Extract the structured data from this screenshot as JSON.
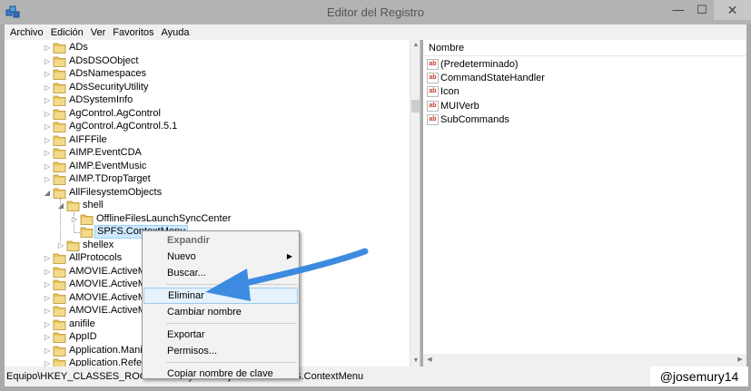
{
  "window": {
    "title": "Editor del Registro",
    "min_glyph": "—",
    "max_glyph": "☐",
    "close_glyph": "✕"
  },
  "menu": [
    "Archivo",
    "Edición",
    "Ver",
    "Favoritos",
    "Ayuda"
  ],
  "tree": [
    {
      "label": "ADs",
      "depth": 0,
      "expander": "collapsed"
    },
    {
      "label": "ADsDSOObject",
      "depth": 0,
      "expander": "collapsed"
    },
    {
      "label": "ADsNamespaces",
      "depth": 0,
      "expander": "collapsed"
    },
    {
      "label": "ADsSecurityUtility",
      "depth": 0,
      "expander": "collapsed"
    },
    {
      "label": "ADSystemInfo",
      "depth": 0,
      "expander": "collapsed"
    },
    {
      "label": "AgControl.AgControl",
      "depth": 0,
      "expander": "collapsed"
    },
    {
      "label": "AgControl.AgControl.5.1",
      "depth": 0,
      "expander": "collapsed"
    },
    {
      "label": "AIFFFile",
      "depth": 0,
      "expander": "collapsed"
    },
    {
      "label": "AIMP.EventCDA",
      "depth": 0,
      "expander": "collapsed"
    },
    {
      "label": "AIMP.EventMusic",
      "depth": 0,
      "expander": "collapsed"
    },
    {
      "label": "AIMP.TDropTarget",
      "depth": 0,
      "expander": "collapsed"
    },
    {
      "label": "AllFilesystemObjects",
      "depth": 0,
      "expander": "expanded"
    },
    {
      "label": "shell",
      "depth": 1,
      "expander": "expanded"
    },
    {
      "label": "OfflineFilesLaunchSyncCenter",
      "depth": 2,
      "expander": "collapsed"
    },
    {
      "label": "SPFS.ContextMenu",
      "depth": 2,
      "expander": "none",
      "selected": true
    },
    {
      "label": "shellex",
      "depth": 1,
      "expander": "collapsed"
    },
    {
      "label": "AllProtocols",
      "depth": 0,
      "expander": "collapsed"
    },
    {
      "label": "AMOVIE.ActiveMovie Control",
      "depth": 0,
      "expander": "collapsed"
    },
    {
      "label": "AMOVIE.ActiveMovie Control.2",
      "depth": 0,
      "expander": "collapsed"
    },
    {
      "label": "AMOVIE.ActiveMovieControl",
      "depth": 0,
      "expander": "collapsed"
    },
    {
      "label": "AMOVIE.ActiveMovieControl.2",
      "depth": 0,
      "expander": "collapsed"
    },
    {
      "label": "anifile",
      "depth": 0,
      "expander": "collapsed"
    },
    {
      "label": "AppID",
      "depth": 0,
      "expander": "collapsed"
    },
    {
      "label": "Application.Manifest",
      "depth": 0,
      "expander": "collapsed"
    },
    {
      "label": "Application.Reference",
      "depth": 0,
      "expander": "collapsed"
    }
  ],
  "values": {
    "header": "Nombre",
    "icon_text": "ab",
    "items": [
      "(Predeterminado)",
      "CommandStateHandler",
      "Icon",
      "MUIVerb",
      "SubCommands"
    ]
  },
  "context_menu": [
    {
      "label": "Expandir",
      "type": "item",
      "disabled": true
    },
    {
      "label": "Nuevo",
      "type": "item",
      "submenu": true
    },
    {
      "label": "Buscar...",
      "type": "item"
    },
    {
      "type": "separator"
    },
    {
      "label": "Eliminar",
      "type": "item",
      "highlighted": true
    },
    {
      "label": "Cambiar nombre",
      "type": "item"
    },
    {
      "type": "separator"
    },
    {
      "label": "Exportar",
      "type": "item"
    },
    {
      "label": "Permisos...",
      "type": "item"
    },
    {
      "type": "separator"
    },
    {
      "label": "Copiar nombre de clave",
      "type": "item"
    }
  ],
  "status_path": "Equipo\\HKEY_CLASSES_ROOT\\AllFilesystemObjects\\shell\\SPFS.ContextMenu",
  "watermark": "@josemury14",
  "colors": {
    "annotation_arrow": "#3d8be0",
    "selection": "#cde8ff",
    "folder": "#e8c45a"
  }
}
